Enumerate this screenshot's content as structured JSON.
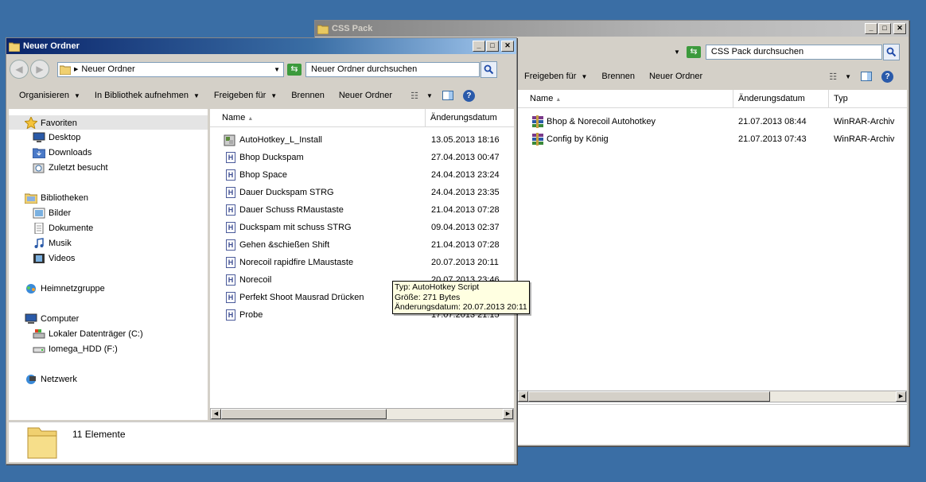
{
  "back_window": {
    "title": "CSS Pack",
    "search_placeholder": "CSS Pack durchsuchen",
    "toolbar": {
      "share": "Freigeben für",
      "burn": "Brennen",
      "new_folder": "Neuer Ordner"
    },
    "columns": {
      "name": "Name",
      "date": "Änderungsdatum",
      "type": "Typ"
    },
    "files": [
      {
        "name": "Bhop & Norecoil Autohotkey",
        "date": "21.07.2013 08:44",
        "type": "WinRAR-Archiv"
      },
      {
        "name": "Config  by König",
        "date": "21.07.2013 07:43",
        "type": "WinRAR-Archiv"
      }
    ]
  },
  "front_window": {
    "title": "Neuer Ordner",
    "address": "Neuer Ordner",
    "search_placeholder": "Neuer Ordner durchsuchen",
    "toolbar": {
      "organize": "Organisieren",
      "library": "In Bibliothek aufnehmen",
      "share": "Freigeben für",
      "burn": "Brennen",
      "new_folder": "Neuer Ordner"
    },
    "columns": {
      "name": "Name",
      "date": "Änderungsdatum"
    },
    "nav": {
      "favorites": "Favoriten",
      "desktop": "Desktop",
      "downloads": "Downloads",
      "recent": "Zuletzt besucht",
      "libraries": "Bibliotheken",
      "pictures": "Bilder",
      "documents": "Dokumente",
      "music": "Musik",
      "videos": "Videos",
      "homegroup": "Heimnetzgruppe",
      "computer": "Computer",
      "drive_c": "Lokaler Datenträger (C:)",
      "drive_f": "Iomega_HDD (F:)",
      "network": "Netzwerk"
    },
    "files": [
      {
        "name": "AutoHotkey_L_Install",
        "date": "13.05.2013 18:16",
        "icon": "installer"
      },
      {
        "name": "Bhop Duckspam",
        "date": "27.04.2013 00:47",
        "icon": "ahk-script"
      },
      {
        "name": "Bhop Space",
        "date": "24.04.2013 23:24",
        "icon": "ahk-script"
      },
      {
        "name": "Dauer Duckspam STRG",
        "date": "24.04.2013 23:35",
        "icon": "ahk-script"
      },
      {
        "name": "Dauer Schuss RMaustaste",
        "date": "21.04.2013 07:28",
        "icon": "ahk-script"
      },
      {
        "name": "Duckspam mit schuss STRG",
        "date": "09.04.2013 02:37",
        "icon": "ahk-script"
      },
      {
        "name": "Gehen &schießen Shift",
        "date": "21.04.2013 07:28",
        "icon": "ahk-script"
      },
      {
        "name": "Norecoil rapidfire LMaustaste",
        "date": "20.07.2013 20:11",
        "icon": "ahk-script"
      },
      {
        "name": "Norecoil",
        "date": "20.07.2013 23:46",
        "icon": "ahk-script"
      },
      {
        "name": "Perfekt Shoot Mausrad Drücken",
        "date": "",
        "icon": "ahk-script"
      },
      {
        "name": "Probe",
        "date": "17.07.2013 21:15",
        "icon": "ahk-script"
      }
    ],
    "status": "11 Elemente",
    "tooltip": {
      "line1": "Typ: AutoHotkey Script",
      "line2": "Größe: 271 Bytes",
      "line3": "Änderungsdatum: 20.07.2013 20:11"
    }
  }
}
